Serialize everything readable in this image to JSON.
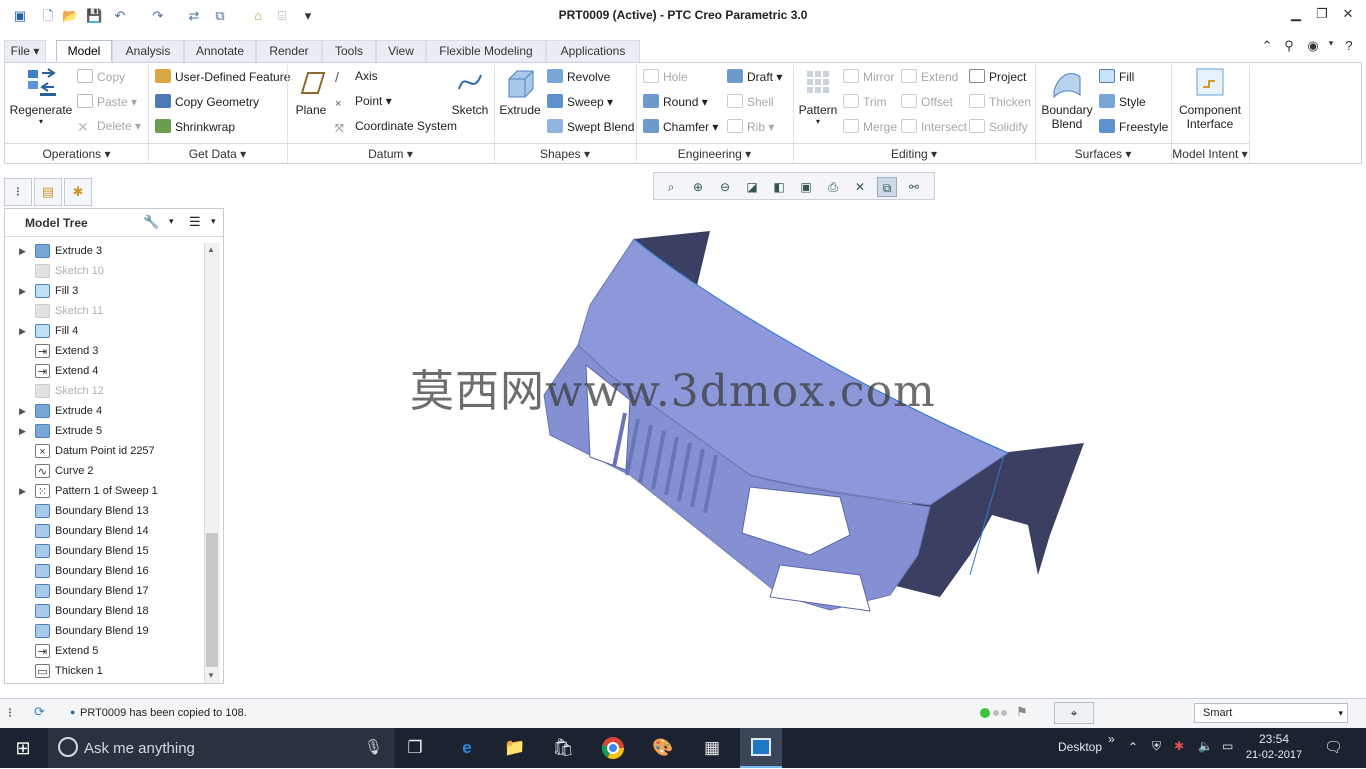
{
  "window": {
    "title": "PRT0009 (Active) - PTC Creo Parametric 3.0"
  },
  "menu_tabs": [
    "File",
    "Model",
    "Analysis",
    "Annotate",
    "Render",
    "Tools",
    "View",
    "Flexible Modeling",
    "Applications"
  ],
  "active_tab": "Model",
  "ribbon": {
    "operations": {
      "regenerate": "Regenerate",
      "copy": "Copy",
      "paste": "Paste",
      "delete": "Delete",
      "group": "Operations"
    },
    "get_data": {
      "udf": "User-Defined Feature",
      "copy_geometry": "Copy Geometry",
      "shrinkwrap": "Shrinkwrap",
      "group": "Get Data"
    },
    "datum": {
      "plane": "Plane",
      "axis": "Axis",
      "point": "Point",
      "csys": "Coordinate System",
      "sketch": "Sketch",
      "group": "Datum"
    },
    "shapes": {
      "extrude": "Extrude",
      "revolve": "Revolve",
      "sweep": "Sweep",
      "swept_blend": "Swept Blend",
      "group": "Shapes"
    },
    "engineering": {
      "hole": "Hole",
      "round": "Round",
      "chamfer": "Chamfer",
      "draft": "Draft",
      "shell": "Shell",
      "rib": "Rib",
      "group": "Engineering"
    },
    "editing": {
      "pattern": "Pattern",
      "mirror": "Mirror",
      "trim": "Trim",
      "merge": "Merge",
      "extend": "Extend",
      "offset": "Offset",
      "intersect": "Intersect",
      "project": "Project",
      "thicken": "Thicken",
      "solidify": "Solidify",
      "group": "Editing"
    },
    "surfaces": {
      "boundary_blend_1": "Boundary",
      "boundary_blend_2": "Blend",
      "fill": "Fill",
      "style": "Style",
      "freestyle": "Freestyle",
      "group": "Surfaces"
    },
    "model_intent": {
      "component_interface_1": "Component",
      "component_interface_2": "Interface",
      "group": "Model Intent"
    }
  },
  "model_tree": {
    "title": "Model Tree",
    "items": [
      {
        "label": "Extrude 3",
        "type": "extrude",
        "expandable": true,
        "dim": false
      },
      {
        "label": "Sketch 10",
        "type": "sketch",
        "expandable": false,
        "dim": true
      },
      {
        "label": "Fill 3",
        "type": "fill",
        "expandable": true,
        "dim": false
      },
      {
        "label": "Sketch 11",
        "type": "sketch",
        "expandable": false,
        "dim": true
      },
      {
        "label": "Fill 4",
        "type": "fill",
        "expandable": true,
        "dim": false
      },
      {
        "label": "Extend 3",
        "type": "extend",
        "expandable": false,
        "dim": false
      },
      {
        "label": "Extend 4",
        "type": "extend",
        "expandable": false,
        "dim": false
      },
      {
        "label": "Sketch 12",
        "type": "sketch",
        "expandable": false,
        "dim": true
      },
      {
        "label": "Extrude 4",
        "type": "extrude",
        "expandable": true,
        "dim": false
      },
      {
        "label": "Extrude 5",
        "type": "extrude",
        "expandable": true,
        "dim": false
      },
      {
        "label": "Datum Point id 2257",
        "type": "point",
        "expandable": false,
        "dim": false
      },
      {
        "label": "Curve 2",
        "type": "curve",
        "expandable": false,
        "dim": false
      },
      {
        "label": "Pattern 1 of Sweep 1",
        "type": "pattern",
        "expandable": true,
        "dim": false
      },
      {
        "label": "Boundary Blend 13",
        "type": "blend",
        "expandable": false,
        "dim": false
      },
      {
        "label": "Boundary Blend 14",
        "type": "blend",
        "expandable": false,
        "dim": false
      },
      {
        "label": "Boundary Blend 15",
        "type": "blend",
        "expandable": false,
        "dim": false
      },
      {
        "label": "Boundary Blend 16",
        "type": "blend",
        "expandable": false,
        "dim": false
      },
      {
        "label": "Boundary Blend 17",
        "type": "blend",
        "expandable": false,
        "dim": false
      },
      {
        "label": "Boundary Blend 18",
        "type": "blend",
        "expandable": false,
        "dim": false
      },
      {
        "label": "Boundary Blend 19",
        "type": "blend",
        "expandable": false,
        "dim": false
      },
      {
        "label": "Extend 5",
        "type": "extend",
        "expandable": false,
        "dim": false
      },
      {
        "label": "Thicken 1",
        "type": "thicken",
        "expandable": false,
        "dim": false
      }
    ]
  },
  "watermark": "莫西网www.3dmox.com",
  "status": {
    "message": "PRT0009 has been copied to 108.",
    "filter": "Smart"
  },
  "taskbar": {
    "search_placeholder": "Ask me anything",
    "desktop_label": "Desktop",
    "time": "23:54",
    "date": "21-02-2017"
  },
  "colors": {
    "model_face": "#8b96d8",
    "model_shadow": "#3c4163",
    "accent": "#1f6fb5",
    "taskbar": "#1b2330"
  }
}
